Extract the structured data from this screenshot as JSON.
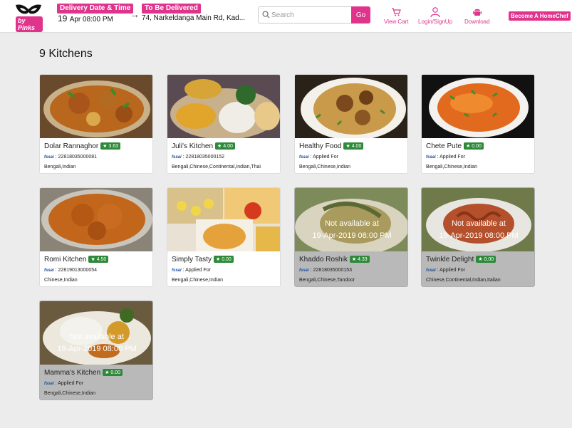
{
  "header": {
    "logo_text": "by Pinks",
    "delivery_label": "Delivery Date & Time",
    "delivery_day": "19",
    "delivery_rest": "Apr 08:00 PM",
    "deliver_to_label": "To Be Delivered",
    "address": "74, Narkeldanga Main Rd, Kad...",
    "search_placeholder": "Search",
    "go_label": "Go",
    "view_cart": "View Cart",
    "login": "Login/SignUp",
    "download": "Download",
    "become_homechef": "Become A HomeChef"
  },
  "heading": "9 Kitchens",
  "kitchens": [
    {
      "name": "Dolar Rannaghor",
      "rating": "3.63",
      "license": "22818035000081",
      "cuisine": "Bengali,Indian",
      "na_line1": "",
      "na_line2": ""
    },
    {
      "name": "Juli's Kitchen",
      "rating": "4.00",
      "license": "22818035000152",
      "cuisine": "Bengali,Chinese,Continental,Indian,Thai",
      "na_line1": "",
      "na_line2": ""
    },
    {
      "name": "Healthy Food",
      "rating": "4.00",
      "license": "Applied For",
      "cuisine": "Bengali,Chinese,Indian",
      "na_line1": "",
      "na_line2": ""
    },
    {
      "name": "Chete Pute",
      "rating": "0.00",
      "license": "Applied For",
      "cuisine": "Bengali,Chinese,Indian",
      "na_line1": "",
      "na_line2": ""
    },
    {
      "name": "Romi Kitchen",
      "rating": "4.50",
      "license": "22819013000054",
      "cuisine": "Chinese,Indian",
      "na_line1": "",
      "na_line2": ""
    },
    {
      "name": "Simply Tasty",
      "rating": "0.00",
      "license": "Applied For",
      "cuisine": "Bengali,Chinese,Indian",
      "na_line1": "",
      "na_line2": ""
    },
    {
      "name": "Khaddo Roshik",
      "rating": "4.33",
      "license": "22818035000153",
      "cuisine": "Bengali,Chinese,Tandoor",
      "na_line1": "Not available at",
      "na_line2": "19-Apr-2019 08:00 PM"
    },
    {
      "name": "Twinkle Delight",
      "rating": "0.00",
      "license": "Applied For",
      "cuisine": "Chinese,Continental,Indian,Italian",
      "na_line1": "Not available at",
      "na_line2": "19-Apr-2019 08:00 PM"
    },
    {
      "name": "Mamma's Kitchen",
      "rating": "0.00",
      "license": "Applied For",
      "cuisine": "Bengali,Chinese,Indian",
      "na_line1": "Not available at",
      "na_line2": "19-Apr-2019 08:00 PM"
    }
  ],
  "fssai_text": "fssai",
  "star_glyph": "★",
  "colors": {
    "brand": "#e0338c",
    "rating": "#2e8a3a"
  }
}
